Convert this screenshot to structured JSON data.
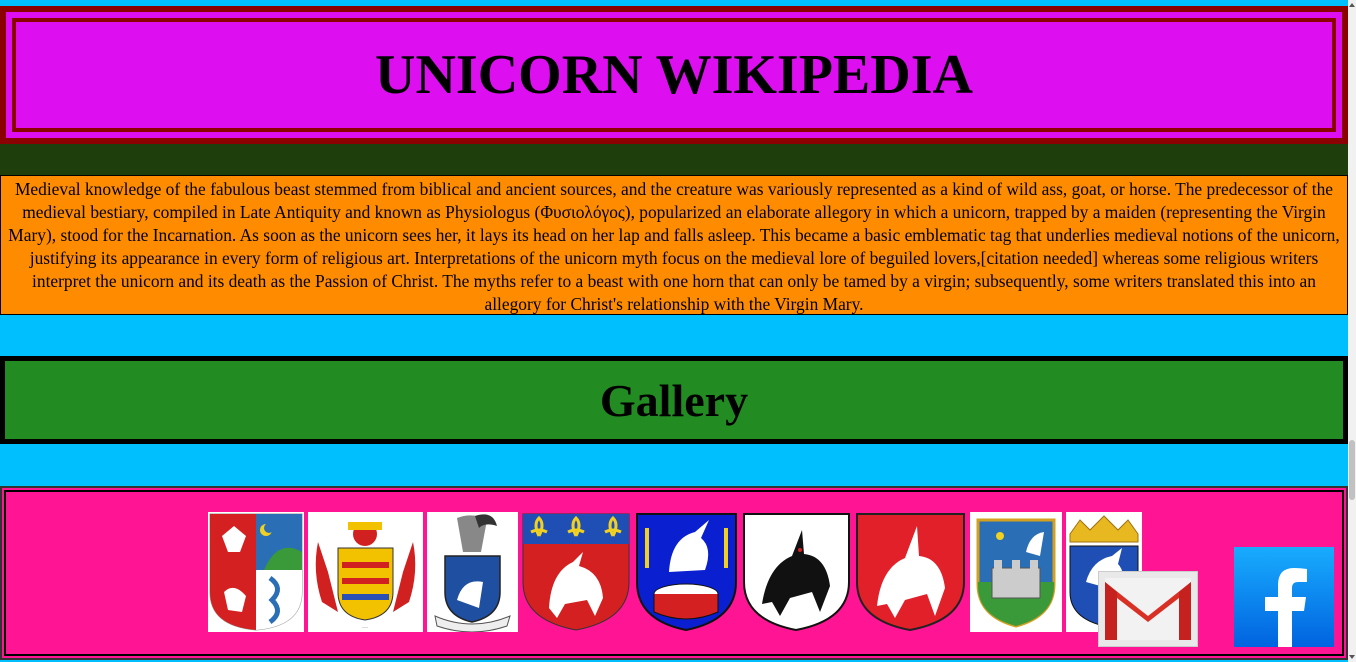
{
  "header": {
    "title": "UNICORN WIKIPEDIA"
  },
  "article": {
    "text": "Medieval knowledge of the fabulous beast stemmed from biblical and ancient sources, and the creature was variously represented as a kind of wild ass, goat, or horse. The predecessor of the medieval bestiary, compiled in Late Antiquity and known as Physiologus (Φυσιολόγος), popularized an elaborate allegory in which a unicorn, trapped by a maiden (representing the Virgin Mary), stood for the Incarnation. As soon as the unicorn sees her, it lays its head on her lap and falls asleep. This became a basic emblematic tag that underlies medieval notions of the unicorn, justifying its appearance in every form of religious art. Interpretations of the unicorn myth focus on the medieval lore of beguiled lovers,[citation needed] whereas some religious writers interpret the unicorn and its death as the Passion of Christ. The myths refer to a beast with one horn that can only be tamed by a virgin; subsequently, some writers translated this into an allegory for Christ's relationship with the Virgin Mary."
  },
  "gallery": {
    "title": "Gallery",
    "images": [
      "coat-of-arms-eagle-unicorn-icon",
      "coat-of-arms-red-yellow-icon",
      "coat-of-arms-blue-unicorn-icon",
      "coat-of-arms-fleur-de-lis-icon",
      "coat-of-arms-drum-unicorn-icon",
      "coat-of-arms-black-unicorn-icon",
      "coat-of-arms-red-unicorn-icon",
      "coat-of-arms-castle-icon",
      "coat-of-arms-crown-icon"
    ]
  },
  "social": {
    "gmail": "gmail-icon",
    "facebook": "facebook-icon"
  },
  "colors": {
    "background": "#00bfff",
    "header_bg": "#dd0ff0",
    "header_border": "#8b0000",
    "dark_band": "#1e3f0c",
    "article_bg": "#ff8c00",
    "gallery_bg": "#228b22",
    "images_bg": "#ff1493"
  }
}
